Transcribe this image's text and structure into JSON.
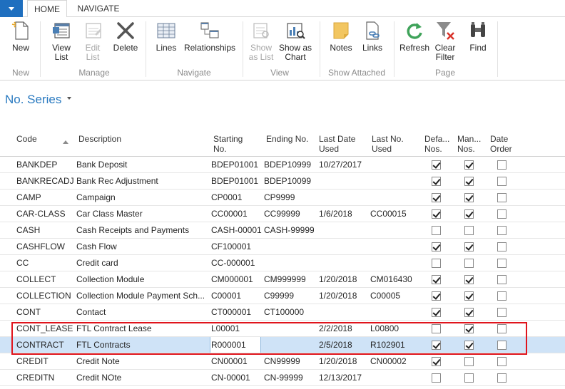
{
  "tabs": {
    "home": "HOME",
    "navigate": "NAVIGATE"
  },
  "ribbon": {
    "buttons": {
      "new": "New",
      "view_list": [
        "View",
        "List"
      ],
      "edit_list": [
        "Edit",
        "List"
      ],
      "delete": "Delete",
      "lines": "Lines",
      "relationships": "Relationships",
      "show_as_list": [
        "Show",
        "as List"
      ],
      "show_as_chart": [
        "Show as",
        "Chart"
      ],
      "notes": "Notes",
      "links": "Links",
      "refresh": "Refresh",
      "clear_filter": [
        "Clear",
        "Filter"
      ],
      "find": "Find"
    },
    "groups": {
      "new": "New",
      "manage": "Manage",
      "navigate": "Navigate",
      "view": "View",
      "show_attached": "Show Attached",
      "page": "Page"
    }
  },
  "page": {
    "title": "No. Series"
  },
  "grid": {
    "headers": {
      "code": "Code",
      "description": "Description",
      "starting_no": [
        "Starting",
        "No."
      ],
      "ending_no": "Ending No.",
      "last_date_used": [
        "Last Date",
        "Used"
      ],
      "last_no_used": [
        "Last No.",
        "Used"
      ],
      "default_nos": [
        "Defa...",
        "Nos."
      ],
      "manual_nos": [
        "Man...",
        "Nos."
      ],
      "date_order": [
        "Date",
        "Order"
      ]
    },
    "rows": [
      {
        "code": "BANKDEP",
        "description": "Bank Deposit",
        "starting": "BDEP01001",
        "ending": "BDEP10999",
        "last_date": "10/27/2017",
        "last_no": "",
        "default": true,
        "manual": true,
        "date_order": false
      },
      {
        "code": "BANKRECADJ",
        "description": "Bank Rec Adjustment",
        "starting": "BDEP01001",
        "ending": "BDEP10099",
        "last_date": "",
        "last_no": "",
        "default": true,
        "manual": true,
        "date_order": false
      },
      {
        "code": "CAMP",
        "description": "Campaign",
        "starting": "CP0001",
        "ending": "CP9999",
        "last_date": "",
        "last_no": "",
        "default": true,
        "manual": true,
        "date_order": false
      },
      {
        "code": "CAR-CLASS",
        "description": "Car Class Master",
        "starting": "CC00001",
        "ending": "CC99999",
        "last_date": "1/6/2018",
        "last_no": "CC00015",
        "default": true,
        "manual": true,
        "date_order": false
      },
      {
        "code": "CASH",
        "description": "Cash Receipts and Payments",
        "starting": "CASH-00001",
        "ending": "CASH-99999",
        "last_date": "",
        "last_no": "",
        "default": false,
        "manual": false,
        "date_order": false
      },
      {
        "code": "CASHFLOW",
        "description": "Cash Flow",
        "starting": "CF100001",
        "ending": "",
        "last_date": "",
        "last_no": "",
        "default": true,
        "manual": true,
        "date_order": false
      },
      {
        "code": "CC",
        "description": "Credit card",
        "starting": "CC-000001",
        "ending": "",
        "last_date": "",
        "last_no": "",
        "default": false,
        "manual": false,
        "date_order": false
      },
      {
        "code": "COLLECT",
        "description": "Collection Module",
        "starting": "CM000001",
        "ending": "CM999999",
        "last_date": "1/20/2018",
        "last_no": "CM016430",
        "default": true,
        "manual": true,
        "date_order": false
      },
      {
        "code": "COLLECTION",
        "description": "Collection Module Payment Sch...",
        "starting": "C00001",
        "ending": "C99999",
        "last_date": "1/20/2018",
        "last_no": "C00005",
        "default": true,
        "manual": true,
        "date_order": false
      },
      {
        "code": "CONT",
        "description": "Contact",
        "starting": "CT000001",
        "ending": "CT100000",
        "last_date": "",
        "last_no": "",
        "default": true,
        "manual": true,
        "date_order": false
      },
      {
        "code": "CONT_LEASE",
        "description": "FTL Contract Lease",
        "starting": "L00001",
        "ending": "",
        "last_date": "2/2/2018",
        "last_no": "L00800",
        "default": false,
        "manual": true,
        "date_order": false
      },
      {
        "code": "CONTRACT",
        "description": "FTL Contracts",
        "starting": "R000001",
        "ending": "",
        "last_date": "2/5/2018",
        "last_no": "R102901",
        "default": true,
        "manual": true,
        "date_order": false
      },
      {
        "code": "CREDIT",
        "description": "Credit Note",
        "starting": "CN00001",
        "ending": "CN99999",
        "last_date": "1/20/2018",
        "last_no": "CN00002",
        "default": true,
        "manual": false,
        "date_order": false
      },
      {
        "code": "CREDITN",
        "description": "Credit NOte",
        "starting": "CN-00001",
        "ending": "CN-99999",
        "last_date": "12/13/2017",
        "last_no": "",
        "default": false,
        "manual": false,
        "date_order": false
      }
    ]
  }
}
